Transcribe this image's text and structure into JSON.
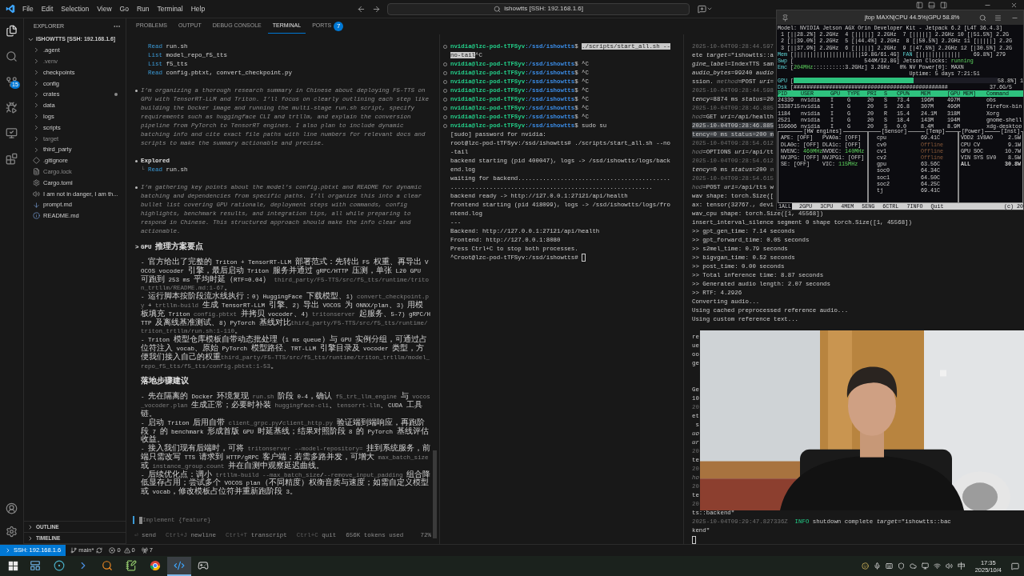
{
  "menu": [
    "File",
    "Edit",
    "Selection",
    "View",
    "Go",
    "Run",
    "Terminal",
    "Help"
  ],
  "search": {
    "value": "ishowtts [SSH: 192.168.1.6]"
  },
  "activity": {
    "scm_badge": "15"
  },
  "explorer": {
    "title": "EXPLORER",
    "root": "ISHOWTTS [SSH: 192.168.1.6]",
    "items": [
      {
        "name": ".agent",
        "kind": "folder",
        "dimmed": false,
        "modified": false
      },
      {
        "name": ".venv",
        "kind": "folder",
        "dimmed": true,
        "modified": false
      },
      {
        "name": "checkpoints",
        "kind": "folder",
        "dimmed": false,
        "modified": false
      },
      {
        "name": "config",
        "kind": "folder",
        "dimmed": false,
        "modified": false
      },
      {
        "name": "crates",
        "kind": "folder",
        "dimmed": false,
        "modified": true
      },
      {
        "name": "data",
        "kind": "folder",
        "dimmed": false,
        "modified": false
      },
      {
        "name": "logs",
        "kind": "folder",
        "dimmed": false,
        "modified": false
      },
      {
        "name": "scripts",
        "kind": "folder",
        "dimmed": false,
        "modified": false
      },
      {
        "name": "target",
        "kind": "folder",
        "dimmed": true,
        "modified": false
      },
      {
        "name": "third_party",
        "kind": "folder",
        "dimmed": false,
        "modified": false
      },
      {
        "name": ".gitignore",
        "kind": "ignore",
        "dimmed": false,
        "modified": false
      },
      {
        "name": "Cargo.lock",
        "kind": "lock",
        "dimmed": true,
        "modified": false
      },
      {
        "name": "Cargo.toml",
        "kind": "config",
        "dimmed": false,
        "modified": false
      },
      {
        "name": "I am not in danger, I am th...",
        "kind": "audio",
        "dimmed": false,
        "modified": false
      },
      {
        "name": "prompt.md",
        "kind": "markdown",
        "dimmed": false,
        "modified": false
      },
      {
        "name": "README.md",
        "kind": "readme",
        "dimmed": false,
        "modified": false
      }
    ],
    "sections": [
      "OUTLINE",
      "TIMELINE"
    ]
  },
  "panel_tabs": [
    {
      "label": "PROBLEMS",
      "selected": false
    },
    {
      "label": "OUTPUT",
      "selected": false
    },
    {
      "label": "DEBUG CONSOLE",
      "selected": false
    },
    {
      "label": "TERMINAL",
      "selected": true
    },
    {
      "label": "PORTS",
      "selected": false,
      "badge": "7"
    }
  ],
  "chat": {
    "blocks": [
      {
        "kind": "tool",
        "verb": "Read",
        "args": "run.sh"
      },
      {
        "kind": "tool",
        "verb": "List",
        "args": "model_repo_f5_tts"
      },
      {
        "kind": "tool",
        "verb": "List",
        "args": "f5_tts"
      },
      {
        "kind": "tool",
        "verb": "Read",
        "args": "config.pbtxt, convert_checkpoint.py"
      },
      {
        "kind": "thought",
        "text": "I’m organizing a thorough research summary in Chinese about deploying F5-TTS on GPU with TensorRT-LLM and Triton. I’ll focus on clearly outlining each step like building the Docker image and running the multi-stage run.sh script, specify requirements such as huggingface CLI and trtllm, and explain the conversion pipeline from PyTorch to TensorRT engines. I also plan to include dynamic batching info and cite exact file paths with line numbers for relevant docs and scripts to make the summary actionable and precise."
      },
      {
        "kind": "explored",
        "title": "Explored",
        "branch": "└",
        "verb": "Read",
        "args": "run.sh"
      },
      {
        "kind": "thought",
        "text": "I’m gathering key points about the model’s config.pbtxt and README for dynamic batching and dependencies from specific paths. I’ll organize this into a clear bullet list covering GPU rationale, deployment steps with commands, config highlights, benchmark results, and integration tips, all while preparing to respond in Chinese. This structured approach should make the info clear and actionable."
      },
      {
        "kind": "heading",
        "marker": ">",
        "text": "GPU 推理方案要点"
      },
      {
        "kind": "para",
        "segments": [
          {
            "kind": "text",
            "text": "- 官方给出了完整的 Triton + TensorRT-LLM 部署范式：先转出 F5 权重、再导出 VOCOS vocoder 引擎，最后启动 Triton 服务并通过 gRPC/HTTP 压测，单张 L20 GPU 可跑到 253 ms 平均时延（RTF≈0.04） "
          },
          {
            "kind": "code",
            "text": "third_party/F5-TTS/src/f5_tts/runtime/triton_trtllm/README.md:1-67"
          },
          {
            "kind": "text",
            "text": "。"
          }
        ]
      },
      {
        "kind": "para",
        "segments": [
          {
            "kind": "text",
            "text": "- 运行脚本按阶段流水线执行：0) HuggingFace 下载模型、1) "
          },
          {
            "kind": "code",
            "text": "convert_checkpoint.py"
          },
          {
            "kind": "text",
            "text": " + "
          },
          {
            "kind": "code",
            "text": "trtllm-build"
          },
          {
            "kind": "text",
            "text": " 生成 TensorRT-LLM 引擎、2) 导出 VOCOS 为 ONNX/plan、3) 用模板填充 Triton "
          },
          {
            "kind": "code",
            "text": "config.pbtxt"
          },
          {
            "kind": "text",
            "text": " 并拷贝 vocoder、4) "
          },
          {
            "kind": "code",
            "text": "tritonserver"
          },
          {
            "kind": "text",
            "text": " 起服务、5-7) gRPC/HTTP 及离线基准测试、8) PyTorch 基线对比"
          },
          {
            "kind": "code",
            "text": "third_party/F5-TTS/src/f5_tts/runtime/triton_trtllm/run.sh:1-110"
          },
          {
            "kind": "text",
            "text": "。"
          }
        ]
      },
      {
        "kind": "para",
        "segments": [
          {
            "kind": "text",
            "text": "- Triton 模型仓库模板自带动态批处理（1 ms queue）与 GPU 实例分组，可通过占位符注入 vocab、原始 PyTorch 模型路径、TRT-LLM 引擎目录及 vocoder 类型，方便我们接入自己的权重"
          },
          {
            "kind": "code",
            "text": "third_party/F5-TTS/src/f5_tts/runtime/triton_trtllm/model_repo_f5_tts/f5_tts/config.pbtxt:1-53"
          },
          {
            "kind": "text",
            "text": "。"
          }
        ]
      },
      {
        "kind": "heading",
        "text": "落地步骤建议"
      },
      {
        "kind": "para",
        "segments": [
          {
            "kind": "text",
            "text": "- 先在隔离的 Docker 环境复现 "
          },
          {
            "kind": "code",
            "text": "run.sh"
          },
          {
            "kind": "text",
            "text": " 阶段 0-4，确认 "
          },
          {
            "kind": "code",
            "text": "f5_trt_llm_engine"
          },
          {
            "kind": "text",
            "text": " 与 "
          },
          {
            "kind": "code",
            "text": "vocos_vocoder.plan"
          },
          {
            "kind": "text",
            "text": " 生成正常；必要时补装 "
          },
          {
            "kind": "code",
            "text": "huggingface-cli"
          },
          {
            "kind": "text",
            "text": "、"
          },
          {
            "kind": "code",
            "text": "tensorrt-llm"
          },
          {
            "kind": "text",
            "text": "、CUDA 工具链。"
          }
        ]
      },
      {
        "kind": "para",
        "segments": [
          {
            "kind": "text",
            "text": "- 启动 Triton 后用自带 "
          },
          {
            "kind": "code",
            "text": "client_grpc.py"
          },
          {
            "kind": "text",
            "text": "/"
          },
          {
            "kind": "code",
            "text": "client_http.py"
          },
          {
            "kind": "text",
            "text": " 验证端到端响应，再跑阶段 7 的 benchmark 形成首版 GPU 时延基线；结果对照阶段 8 的 PyTorch 基线评估收益。"
          }
        ]
      },
      {
        "kind": "para",
        "segments": [
          {
            "kind": "text",
            "text": "- 接入我们现有后端时，可将 "
          },
          {
            "kind": "code",
            "text": "tritonserver --model-repository="
          },
          {
            "kind": "text",
            "text": " 挂到系统服务，前端只需改写 TTS 请求到 HTTP/gRPC 客户端；若需多路并发，可增大 "
          },
          {
            "kind": "code",
            "text": "max_batch_size"
          },
          {
            "kind": "text",
            "text": " 或 "
          },
          {
            "kind": "code",
            "text": "instance_group.count"
          },
          {
            "kind": "text",
            "text": " 并在自测中观察延迟曲线。"
          }
        ]
      },
      {
        "kind": "para",
        "segments": [
          {
            "kind": "text",
            "text": "- 后续优化点：调小 "
          },
          {
            "kind": "code",
            "text": "trtllm-build --max_batch_size"
          },
          {
            "kind": "text",
            "text": "/"
          },
          {
            "kind": "code",
            "text": "--remove_input_padding"
          },
          {
            "kind": "text",
            "text": " 组合降低显存占用；尝试多个 VOCOS plan（不同精度）权衡音质与速度；如需自定义模型或 vocab，修改模板占位符并重新跑阶段 3。"
          }
        ]
      }
    ],
    "prompt": {
      "placeholder": "Implement {feature}"
    },
    "hints": [
      {
        "key": "⏎",
        "label": "send"
      },
      {
        "key": "Ctrl+J",
        "label": "newline"
      },
      {
        "key": "Ctrl+T",
        "label": "transcript"
      },
      {
        "key": "Ctrl+C",
        "label": "quit"
      }
    ],
    "tokens": "656K tokens used",
    "context": "72%"
  },
  "terminal_2": [
    {
      "kind": "prompt",
      "segments": [
        {
          "kind": "user",
          "text": "nvidia@lzc-pod-tTFSyv"
        },
        {
          "kind": "path",
          "text": ":/ssd/ishowtts"
        },
        {
          "kind": "plain",
          "text": "$ "
        },
        {
          "kind": "sel",
          "text": "./scripts/start_all.sh --no-tail"
        },
        {
          "kind": "plain",
          "text": "^C"
        }
      ]
    },
    {
      "kind": "prompt",
      "segments": [
        {
          "kind": "user",
          "text": "nvidia@lzc-pod-tTFSyv"
        },
        {
          "kind": "path",
          "text": ":/ssd/ishowtts"
        },
        {
          "kind": "plain",
          "text": "$ ^C"
        }
      ]
    },
    {
      "kind": "prompt",
      "segments": [
        {
          "kind": "user",
          "text": "nvidia@lzc-pod-tTFSyv"
        },
        {
          "kind": "path",
          "text": ":/ssd/ishowtts"
        },
        {
          "kind": "plain",
          "text": "$ ^C"
        }
      ]
    },
    {
      "kind": "prompt",
      "segments": [
        {
          "kind": "user",
          "text": "nvidia@lzc-pod-tTFSyv"
        },
        {
          "kind": "path",
          "text": ":/ssd/ishowtts"
        },
        {
          "kind": "plain",
          "text": "$ ^C"
        }
      ]
    },
    {
      "kind": "prompt",
      "segments": [
        {
          "kind": "user",
          "text": "nvidia@lzc-pod-tTFSyv"
        },
        {
          "kind": "path",
          "text": ":/ssd/ishowtts"
        },
        {
          "kind": "plain",
          "text": "$ ^C"
        }
      ]
    },
    {
      "kind": "prompt",
      "segments": [
        {
          "kind": "user",
          "text": "nvidia@lzc-pod-tTFSyv"
        },
        {
          "kind": "path",
          "text": ":/ssd/ishowtts"
        },
        {
          "kind": "plain",
          "text": "$ ^C"
        }
      ]
    },
    {
      "kind": "prompt",
      "segments": [
        {
          "kind": "user",
          "text": "nvidia@lzc-pod-tTFSyv"
        },
        {
          "kind": "path",
          "text": ":/ssd/ishowtts"
        },
        {
          "kind": "plain",
          "text": "$ ^C"
        }
      ]
    },
    {
      "kind": "prompt",
      "segments": [
        {
          "kind": "user",
          "text": "nvidia@lzc-pod-tTFSyv"
        },
        {
          "kind": "path",
          "text": ":/ssd/ishowtts"
        },
        {
          "kind": "plain",
          "text": "$ ^C"
        }
      ]
    },
    {
      "kind": "prompt",
      "segments": [
        {
          "kind": "user",
          "text": "nvidia@lzc-pod-tTFSyv"
        },
        {
          "kind": "path",
          "text": ":/ssd/ishowtts"
        },
        {
          "kind": "plain",
          "text": "$ sudo su"
        }
      ]
    },
    {
      "kind": "output",
      "segments": [
        {
          "kind": "plain",
          "text": "[sudo] password for nvidia:"
        }
      ]
    },
    {
      "kind": "output",
      "segments": [
        {
          "kind": "plain",
          "text": "root@lzc-pod-tTFSyv:/ssd/ishowtts# ./scripts/start_all.sh --no-tail"
        }
      ]
    },
    {
      "kind": "output",
      "segments": [
        {
          "kind": "plain",
          "text": "backend starting (pid 400047), logs -> /ssd/ishowtts/logs/backend.log"
        }
      ]
    },
    {
      "kind": "output",
      "segments": [
        {
          "kind": "plain",
          "text": "waiting for backend...................................................................................................."
        }
      ]
    },
    {
      "kind": "output",
      "segments": [
        {
          "kind": "plain",
          "text": "backend ready -> http://127.0.0.1:27121/api/health"
        }
      ]
    },
    {
      "kind": "output",
      "segments": [
        {
          "kind": "plain",
          "text": "frontend starting (pid 418099), logs -> /ssd/ishowtts/logs/frontend.log"
        }
      ]
    },
    {
      "kind": "output",
      "segments": [
        {
          "kind": "plain",
          "text": "---"
        }
      ]
    },
    {
      "kind": "output",
      "segments": [
        {
          "kind": "plain",
          "text": "Backend: http://127.0.0.1:27121/api/health"
        }
      ]
    },
    {
      "kind": "output",
      "segments": [
        {
          "kind": "plain",
          "text": "Frontend: http://127.0.0.1:8080"
        }
      ]
    },
    {
      "kind": "output",
      "segments": [
        {
          "kind": "plain",
          "text": "Press Ctrl+C to stop both processes."
        }
      ]
    },
    {
      "kind": "output",
      "segments": [
        {
          "kind": "plain",
          "text": "^Croot@lzc-pod-tTFSyv:/ssd/ishowtts# "
        },
        {
          "kind": "cursor"
        }
      ]
    }
  ],
  "terminal_3": [
    {
      "kind": "text",
      "segments": [
        {
          "kind": "dim",
          "text": "2025-10-04T09:28:44.597"
        }
      ]
    },
    {
      "kind": "text",
      "segments": [
        {
          "kind": "plain",
          "text": "ete "
        },
        {
          "kind": "italic",
          "text": "target"
        },
        {
          "kind": "plain",
          "text": "=\"ishowtts::a"
        }
      ]
    },
    {
      "kind": "text",
      "segments": [
        {
          "kind": "italic",
          "text": "gine_label"
        },
        {
          "kind": "plain",
          "text": "=IndexTTS sam"
        }
      ]
    },
    {
      "kind": "text",
      "segments": [
        {
          "kind": "italic",
          "text": "audio_bytes"
        },
        {
          "kind": "plain",
          "text": "=99240 "
        },
        {
          "kind": "italic",
          "text": "audio"
        }
      ]
    },
    {
      "kind": "text",
      "segments": [
        {
          "kind": "plain",
          "text": "ssion. "
        },
        {
          "kind": "dimitalic",
          "text": "method"
        },
        {
          "kind": "plain",
          "text": "=POST "
        },
        {
          "kind": "italic",
          "text": "uri"
        },
        {
          "kind": "plain",
          "text": "="
        }
      ]
    },
    {
      "kind": "text",
      "segments": [
        {
          "kind": "dim",
          "text": "2025-10-04T09:28:44.598"
        }
      ]
    },
    {
      "kind": "text",
      "segments": [
        {
          "kind": "italic",
          "text": "tency"
        },
        {
          "kind": "plain",
          "text": "=8874 ms "
        },
        {
          "kind": "italic",
          "text": "status"
        },
        {
          "kind": "plain",
          "text": "=20"
        }
      ]
    },
    {
      "kind": "text",
      "segments": [
        {
          "kind": "dim",
          "text": "2025-10-04T09:28:46.885"
        }
      ]
    },
    {
      "kind": "text",
      "segments": [
        {
          "kind": "dimitalic",
          "text": "hod"
        },
        {
          "kind": "plain",
          "text": "=GET "
        },
        {
          "kind": "italic",
          "text": "uri"
        },
        {
          "kind": "plain",
          "text": "=/api/health"
        }
      ]
    },
    {
      "kind": "text",
      "segments": [
        {
          "kind": "sel",
          "text": "2025-10-04T09:28:46.885"
        }
      ]
    },
    {
      "kind": "text",
      "segments": [
        {
          "kind": "sel",
          "text": "tency=0 ms status=200 m"
        }
      ]
    },
    {
      "kind": "text",
      "segments": [
        {
          "kind": "dim",
          "text": "2025-10-04T09:28:54.612"
        }
      ]
    },
    {
      "kind": "text",
      "segments": [
        {
          "kind": "dimitalic",
          "text": "hod"
        },
        {
          "kind": "plain",
          "text": "=OPTIONS "
        },
        {
          "kind": "italic",
          "text": "uri"
        },
        {
          "kind": "plain",
          "text": "=/api/tt"
        }
      ]
    },
    {
      "kind": "text",
      "segments": [
        {
          "kind": "dim",
          "text": "2025-10-04T09:28:54.612"
        }
      ]
    },
    {
      "kind": "text",
      "segments": [
        {
          "kind": "italic",
          "text": "tency"
        },
        {
          "kind": "plain",
          "text": "=0 ms "
        },
        {
          "kind": "italic",
          "text": "status"
        },
        {
          "kind": "plain",
          "text": "=200 "
        },
        {
          "kind": "dimitalic",
          "text": "m"
        }
      ]
    },
    {
      "kind": "text",
      "segments": [
        {
          "kind": "dim",
          "text": "2025-10-04T09:28:54.615"
        }
      ]
    },
    {
      "kind": "text",
      "segments": [
        {
          "kind": "dimitalic",
          "text": "hod"
        },
        {
          "kind": "plain",
          "text": "=POST "
        },
        {
          "kind": "italic",
          "text": "uri"
        },
        {
          "kind": "plain",
          "text": "=/api/tts w"
        }
      ]
    },
    {
      "kind": "text",
      "segments": [
        {
          "kind": "plain",
          "text": "wav shape: torch.Size(["
        }
      ]
    },
    {
      "kind": "text",
      "segments": [
        {
          "kind": "plain",
          "text": "ax: tensor(32767., devi"
        }
      ]
    },
    {
      "kind": "text",
      "segments": [
        {
          "kind": "plain",
          "text": "wav_cpu shape: torch.Size([1, 45568])"
        }
      ]
    },
    {
      "kind": "text",
      "segments": [
        {
          "kind": "plain",
          "text": "insert_interval_silence segment 0 shape torch.Size([1, 45568])"
        }
      ]
    },
    {
      "kind": "text",
      "segments": [
        {
          "kind": "plain",
          "text": ">> gpt_gen_time: 7.14 seconds"
        }
      ]
    },
    {
      "kind": "text",
      "segments": [
        {
          "kind": "plain",
          "text": ">> gpt_forward_time: 0.05 seconds"
        }
      ]
    },
    {
      "kind": "text",
      "segments": [
        {
          "kind": "plain",
          "text": ">> s2mel_time: 0.79 seconds"
        }
      ]
    },
    {
      "kind": "text",
      "segments": [
        {
          "kind": "plain",
          "text": ">> bigvgan_time: 0.52 seconds"
        }
      ]
    },
    {
      "kind": "text",
      "segments": [
        {
          "kind": "plain",
          "text": ">> post_time: 0.00 seconds"
        }
      ]
    },
    {
      "kind": "text",
      "segments": [
        {
          "kind": "plain",
          "text": ">> Total inference time: 8.87 seconds"
        }
      ]
    },
    {
      "kind": "text",
      "segments": [
        {
          "kind": "plain",
          "text": ">> Generated audio length: 2.07 seconds"
        }
      ]
    },
    {
      "kind": "text",
      "segments": [
        {
          "kind": "plain",
          "text": ">> RTF: 4.2926"
        }
      ]
    },
    {
      "kind": "text",
      "segments": [
        {
          "kind": "plain",
          "text": "Converting audio..."
        }
      ]
    },
    {
      "kind": "text",
      "segments": [
        {
          "kind": "plain",
          "text": "Using cached preprocessed reference audio..."
        }
      ]
    },
    {
      "kind": "text",
      "segments": [
        {
          "kind": "plain",
          "text": "Using custom reference text..."
        }
      ]
    },
    {
      "kind": "blank"
    },
    {
      "kind": "text",
      "segments": [
        {
          "kind": "plain",
          "text": "re"
        }
      ]
    },
    {
      "kind": "text",
      "segments": [
        {
          "kind": "plain",
          "text": "ue"
        }
      ]
    },
    {
      "kind": "text",
      "segments": [
        {
          "kind": "plain",
          "text": "oo"
        }
      ]
    },
    {
      "kind": "text",
      "segments": [
        {
          "kind": "plain",
          "text": "ge"
        }
      ]
    },
    {
      "kind": "blank"
    },
    {
      "kind": "blank"
    },
    {
      "kind": "text",
      "segments": [
        {
          "kind": "plain",
          "text": "Ge"
        }
      ]
    },
    {
      "kind": "text",
      "segments": [
        {
          "kind": "plain",
          "text": "10"
        }
      ]
    },
    {
      "kind": "text",
      "segments": [
        {
          "kind": "dim",
          "text": "20"
        }
      ]
    },
    {
      "kind": "text",
      "segments": [
        {
          "kind": "plain",
          "text": "et"
        }
      ]
    },
    {
      "kind": "text",
      "segments": [
        {
          "kind": "plain",
          "text": " s"
        }
      ]
    },
    {
      "kind": "text",
      "segments": [
        {
          "kind": "italic",
          "text": "uo"
        }
      ]
    },
    {
      "kind": "text",
      "segments": [
        {
          "kind": "italic",
          "text": "ur"
        }
      ]
    },
    {
      "kind": "text",
      "segments": [
        {
          "kind": "dim",
          "text": "20"
        }
      ]
    },
    {
      "kind": "text",
      "segments": [
        {
          "kind": "plain",
          "text": "te"
        }
      ]
    },
    {
      "kind": "text",
      "segments": [
        {
          "kind": "dim",
          "text": "20"
        }
      ]
    },
    {
      "kind": "text",
      "segments": [
        {
          "kind": "dimitalic",
          "text": "ho"
        }
      ]
    },
    {
      "kind": "text",
      "segments": [
        {
          "kind": "dim",
          "text": "20"
        }
      ]
    },
    {
      "kind": "text",
      "segments": [
        {
          "kind": "plain",
          "text": "te"
        }
      ]
    },
    {
      "kind": "text",
      "segments": [
        {
          "kind": "dim",
          "text": "20"
        }
      ]
    },
    {
      "kind": "text",
      "segments": [
        {
          "kind": "plain",
          "text": "ts::backend\""
        }
      ]
    },
    {
      "kind": "text",
      "segments": [
        {
          "kind": "dim",
          "text": "2025-10-04T09:29:47.827336Z"
        },
        {
          "kind": "info",
          "text": "  INFO"
        },
        {
          "kind": "plain",
          "text": " shutdown complete "
        },
        {
          "kind": "italic",
          "text": "target"
        },
        {
          "kind": "plain",
          "text": "=\"ishowtts::bac"
        }
      ]
    },
    {
      "kind": "text",
      "segments": [
        {
          "kind": "plain",
          "text": "kend\""
        }
      ]
    },
    {
      "kind": "text",
      "segments": [
        {
          "kind": "cursor"
        }
      ]
    }
  ],
  "jtop": {
    "title": "jtop MAXN|CPU 44.5%|GPU 58.8%",
    "lines": [
      [
        {
          "kind": "plain",
          "text": "Model: NVIDIA Jetson AGX Orin Developer Kit - Jetpack 6.2 [L4T 36.4.3]"
        }
      ],
      [
        {
          "kind": "plain",
          "text": " 1 [||28.2%] 2.2GHz  4 [|||||] 2.2GHz  7 [|||||] 2.2GHz 10 [|51.5%] 2.2G"
        }
      ],
      [
        {
          "kind": "plain",
          "text": " 2 [||39.0%] 2.2GHz  5 [|44.4%] 2.2GHz  8 [|50.5%] 2.2GHz 11 [|||||] 2.2G"
        }
      ],
      [
        {
          "kind": "plain",
          "text": " 3 [||37.9%] 2.2GHz  6 [|||||] 2.2GHz  9 [|47.5%] 2.2GHz 12 [|30.5%] 2.2G"
        }
      ],
      [
        {
          "kind": "label",
          "text": "Mem"
        },
        {
          "kind": "plain",
          "text": " [|||||||||||||||||||||19.8G/61.4G] "
        },
        {
          "kind": "label",
          "text": "FAN"
        },
        {
          "kind": "plain",
          "text": " [|||||||||||||    69.8%] 279"
        }
      ],
      [
        {
          "kind": "label",
          "text": "Swp"
        },
        {
          "kind": "plain",
          "text": " [                      544M/32.8G] Jetson Clocks: "
        },
        {
          "kind": "good",
          "text": "running"
        }
      ],
      [
        {
          "kind": "label",
          "text": "Emc"
        },
        {
          "kind": "plain",
          "text": " ["
        },
        {
          "kind": "good",
          "text": "204MHz"
        },
        {
          "kind": "plain",
          "text": "::::::::::3.2GHz] 3.2GHz   0% NV Power[0]: MAXN"
        }
      ],
      [
        {
          "kind": "plain",
          "text": "                                         Uptime: 5 days 7:21:51"
        }
      ]
    ],
    "gpu": {
      "label": "GPU",
      "bracket": "[",
      "level": 0.588,
      "reading": "58.8%] 1"
    },
    "disk": [
      {
        "kind": "label",
        "text": "Dsk"
      },
      {
        "kind": "plain",
        "text": " [################################################             37.6G/5"
      }
    ],
    "processes": {
      "columns": [
        "PID",
        "USER",
        "GPU",
        "TYPE",
        "PRI",
        "S",
        "CPU%",
        "MEM",
        "[GPU MEM]",
        "Command"
      ],
      "rows": [
        [
          "24339",
          "nvidia",
          "I",
          "G",
          "20",
          "S",
          "73.4",
          "196M",
          "497M",
          "obs"
        ],
        [
          "3338715",
          "nvidia",
          "I",
          "G",
          "20",
          "S",
          "26.8",
          "307M",
          "496M",
          "firefox-bin"
        ],
        [
          "1184",
          "nvidia",
          "I",
          "G",
          "20",
          "R",
          "15.4",
          "24.1M",
          "318M",
          "Xorg"
        ],
        [
          "2521",
          "nvidia",
          "I",
          "G",
          "20",
          "S",
          "18.4",
          "143M",
          "194M",
          "gnome-shell"
        ],
        [
          "159606",
          "nvidia",
          "I",
          "G",
          "20",
          "S",
          "0.0",
          "8.4M",
          "8.9M",
          "xdg-desktop"
        ]
      ]
    },
    "engines_title": "[HW engines]",
    "engines": [
      {
        "name": "APE:",
        "value": "[OFF]",
        "on": false
      },
      {
        "name": "PVA0a:",
        "value": "[OFF]",
        "on": false
      },
      {
        "name": "DLA0c:",
        "value": "[OFF]",
        "on": false
      },
      {
        "name": "DLA1c:",
        "value": "[OFF]",
        "on": false
      },
      {
        "name": "NVENC:",
        "value": "460MHz",
        "on": true
      },
      {
        "name": "NVDEC:",
        "value": "140MHz",
        "on": true
      },
      {
        "name": "NVJPG:",
        "value": "[OFF]",
        "on": false
      },
      {
        "name": "NVJPG1:",
        "value": "[OFF]",
        "on": false
      },
      {
        "name": "SE:",
        "value": "[OFF]",
        "on": false
      },
      {
        "name": "VIC:",
        "value": "115MHz",
        "on": true
      }
    ],
    "sensor_title": "[Sensor]",
    "temp_title": "[Temp]",
    "sensors": [
      {
        "name": "cpu",
        "temp": "69.41C",
        "offline": false
      },
      {
        "name": "cv0",
        "temp": "Offline",
        "offline": true
      },
      {
        "name": "cv1",
        "temp": "Offline",
        "offline": true
      },
      {
        "name": "cv2",
        "temp": "Offline",
        "offline": true
      },
      {
        "name": "gpu",
        "temp": "63.56C",
        "offline": false
      },
      {
        "name": "soc0",
        "temp": "64.34C",
        "offline": false
      },
      {
        "name": "soc1",
        "temp": "64.50C",
        "offline": false
      },
      {
        "name": "soc2",
        "temp": "64.25C",
        "offline": false
      },
      {
        "name": "tj",
        "temp": "69.41C",
        "offline": false
      }
    ],
    "power_title": "[Power]",
    "inst_title": "[Inst]",
    "power": [
      {
        "name": "VDD2 1V8AO",
        "value": "2.5W",
        "total": false
      },
      {
        "name": "CPU CV",
        "value": "9.1W",
        "total": false
      },
      {
        "name": "GPU SOC",
        "value": "10.7W",
        "total": false
      },
      {
        "name": "VIN SYS 5V0",
        "value": "8.5W",
        "total": false
      },
      {
        "name": "ALL",
        "value": "30.8W",
        "total": true
      }
    ],
    "menu": [
      {
        "label": "1ALL",
        "selected": true
      },
      {
        "label": "2GPU",
        "selected": false
      },
      {
        "label": "3CPU",
        "selected": false
      },
      {
        "label": "4MEM",
        "selected": false
      },
      {
        "label": "5ENG",
        "selected": false
      },
      {
        "label": "6CTRL",
        "selected": false
      },
      {
        "label": "7INFO",
        "selected": false
      },
      {
        "label": "Quit",
        "selected": false
      }
    ],
    "copyright": "(c) 20"
  },
  "webcam": {
    "kind": "picture"
  },
  "status": {
    "remote": "SSH: 192.168.1.6",
    "branch": "main*",
    "errors": "0",
    "warnings": "0",
    "ports": "7"
  },
  "taskbar": {
    "apps": [
      {
        "kind": "files",
        "active": false
      },
      {
        "kind": "orb",
        "active": false
      },
      {
        "kind": "arrow",
        "active": false
      },
      {
        "kind": "search",
        "active": false
      },
      {
        "kind": "notes",
        "active": false
      },
      {
        "kind": "browser",
        "active": false
      },
      {
        "kind": "code",
        "active": true
      },
      {
        "kind": "game",
        "active": false
      }
    ],
    "ime": "中",
    "time": "17:35",
    "date": "2025/10/4"
  }
}
